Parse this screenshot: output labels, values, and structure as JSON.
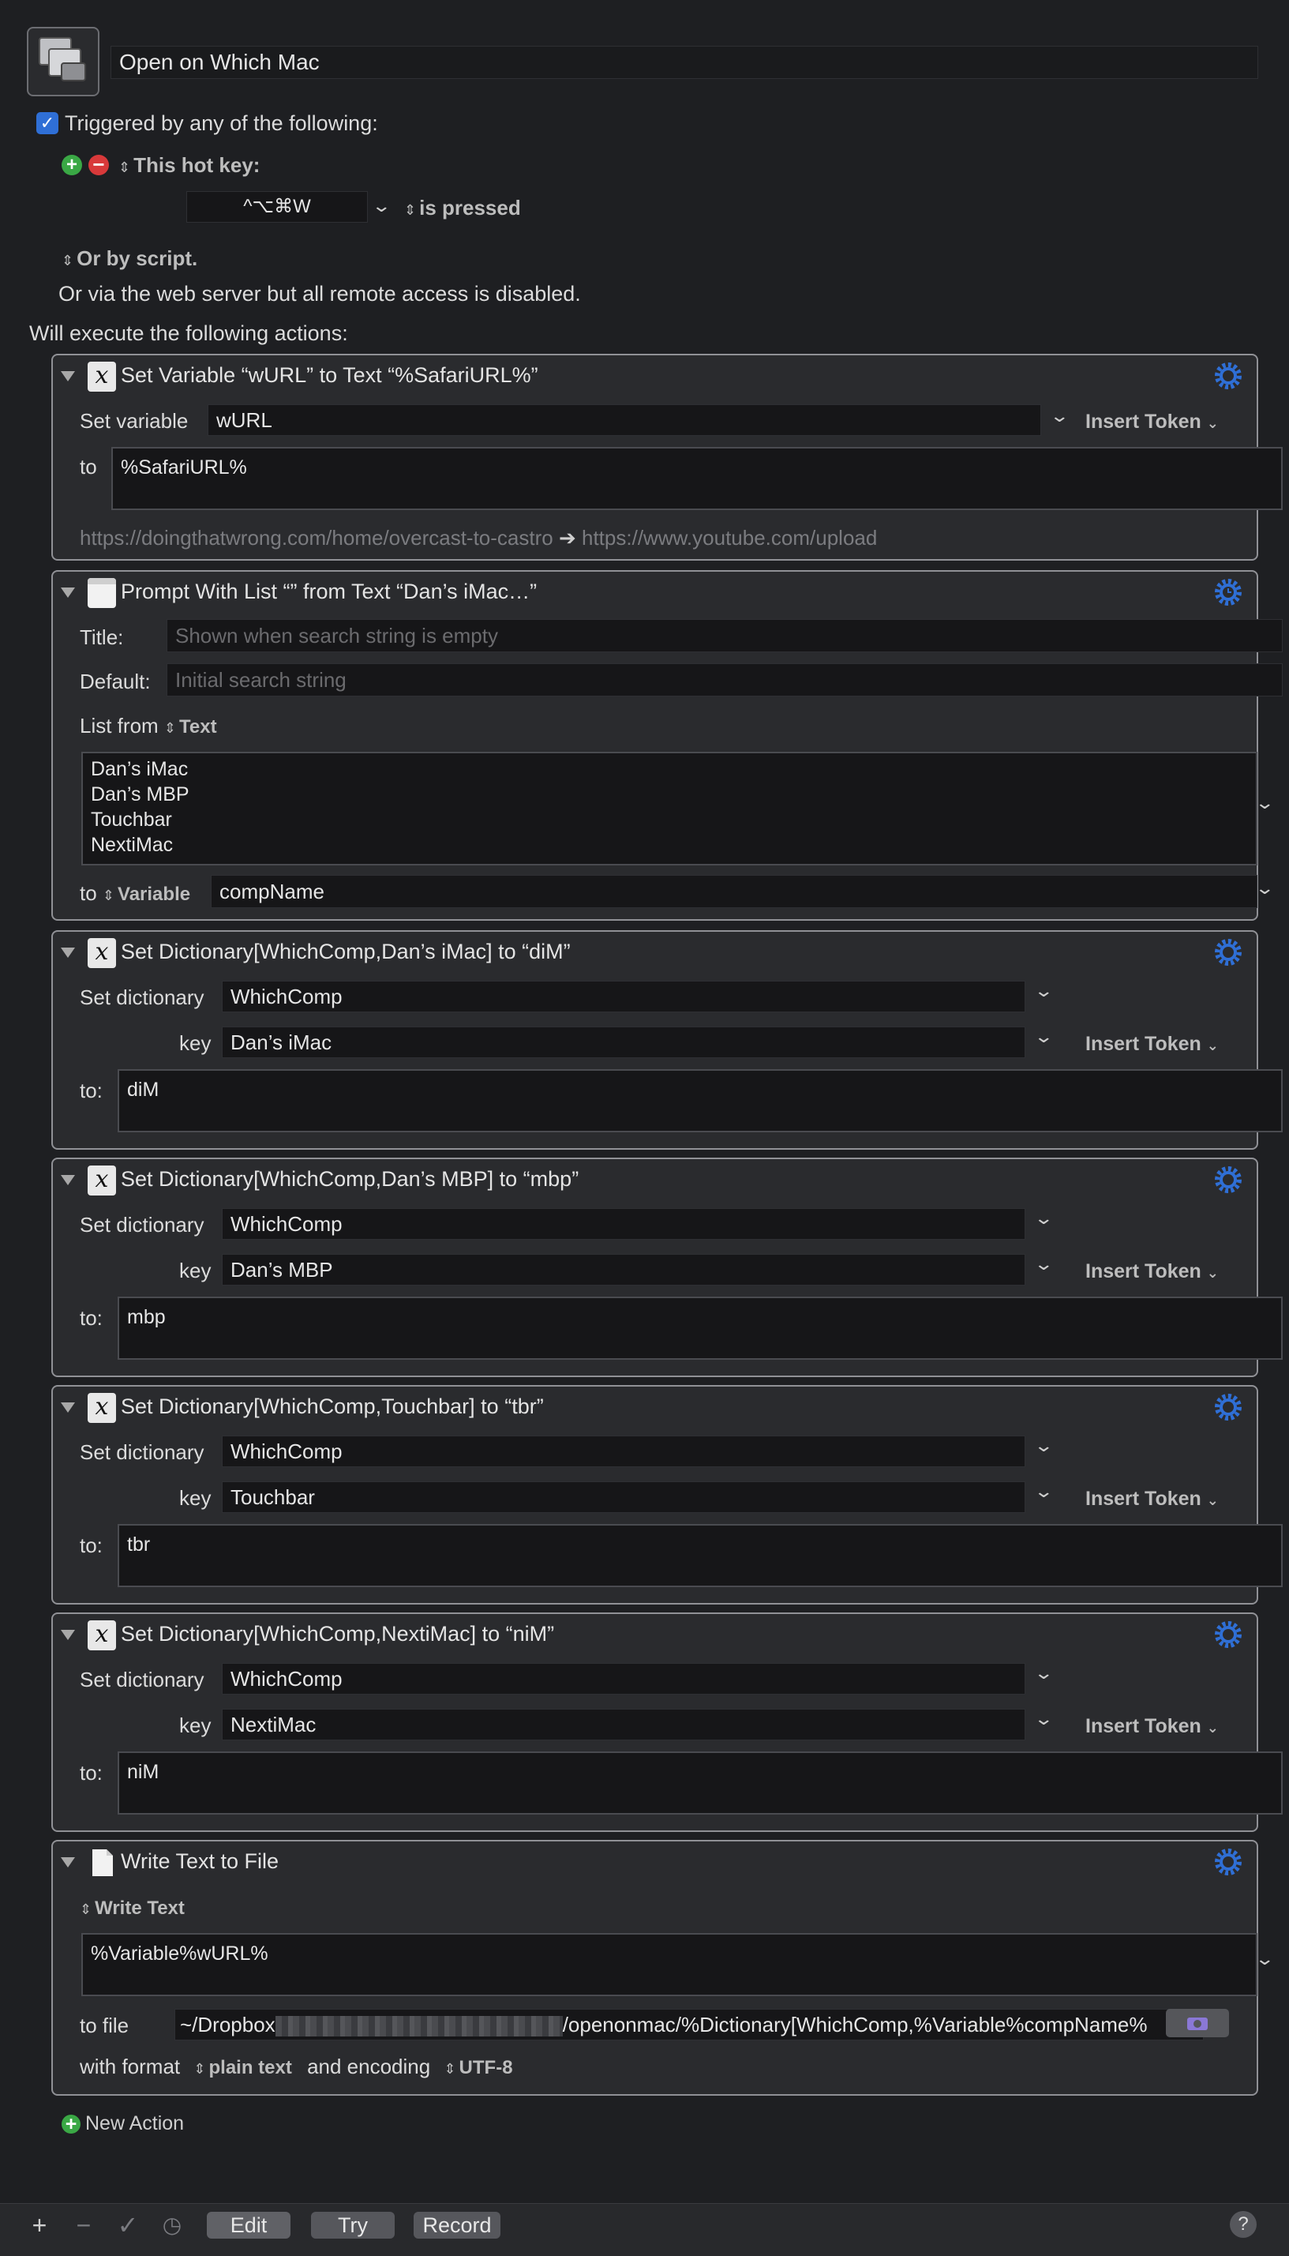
{
  "macro": {
    "name": "Open on Which Mac",
    "trigger_label": "Triggered by any of the following:",
    "hotkey_label": "This hot key:",
    "hotkey_value": "^⌥⌘W",
    "hotkey_state": "is pressed",
    "script_label": "Or by script.",
    "web_server_note": "Or via the web server but all remote access is disabled.",
    "actions_header": "Will execute the following actions:"
  },
  "labels": {
    "insert_token": "Insert Token",
    "set_variable": "Set variable",
    "to": "to",
    "to_colon": "to:",
    "set_dictionary": "Set dictionary",
    "key": "key",
    "title": "Title:",
    "default": "Default:",
    "list_from": "List from",
    "text": "Text",
    "variable": "Variable",
    "write_text": "Write Text",
    "to_file": "to file",
    "with_format": "with format",
    "plain_text": "plain text",
    "and_encoding": "and encoding",
    "utf8": "UTF-8"
  },
  "action1": {
    "title": "Set Variable “wURL” to Text “%SafariURL%”",
    "variable": "wURL",
    "value": "%SafariURL%",
    "preview_from": "https://doingthatwrong.com/home/overcast-to-castro",
    "preview_arrow": "➔",
    "preview_to": "https://www.youtube.com/upload"
  },
  "action2": {
    "title": "Prompt With List “” from Text “Dan’s iMac…”",
    "title_placeholder": "Shown when search string is empty",
    "default_placeholder": "Initial search string",
    "list": "Dan’s iMac\nDan’s MBP\nTouchbar\nNextiMac",
    "variable": "compName"
  },
  "action3": {
    "title": "Set Dictionary[WhichComp,Dan’s iMac] to “diM”",
    "dictionary": "WhichComp",
    "key": "Dan’s iMac",
    "value": "diM"
  },
  "action4": {
    "title": "Set Dictionary[WhichComp,Dan’s MBP] to “mbp”",
    "dictionary": "WhichComp",
    "key": "Dan’s MBP",
    "value": "mbp"
  },
  "action5": {
    "title": "Set Dictionary[WhichComp,Touchbar] to “tbr”",
    "dictionary": "WhichComp",
    "key": "Touchbar",
    "value": "tbr"
  },
  "action6": {
    "title": "Set Dictionary[WhichComp,NextiMac] to “niM”",
    "dictionary": "WhichComp",
    "key": "NextiMac",
    "value": "niM"
  },
  "action7": {
    "title": "Write Text to File",
    "text": "%Variable%wURL%",
    "file_prefix": "~/Dropbox",
    "file_suffix": "/openonmac/%Dictionary[WhichComp,%Variable%compName%"
  },
  "new_action": "New Action",
  "toolbar": {
    "edit": "Edit",
    "try": "Try",
    "record": "Record",
    "help": "?"
  },
  "colors": {
    "accent": "#2f6fd6",
    "add_green": "#3aa845",
    "remove_red": "#d8393a",
    "border": "#909196"
  }
}
